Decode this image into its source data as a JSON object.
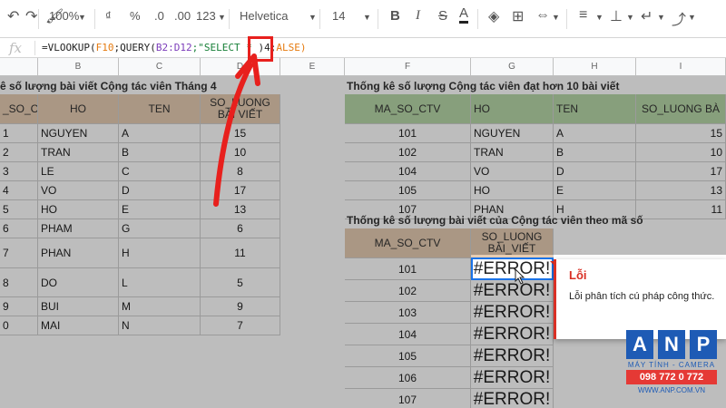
{
  "toolbar": {
    "zoom": "100%",
    "currency": "₫",
    "percent": "%",
    "decimal_less": ".0",
    "decimal_more": ".00",
    "number_format": "123",
    "font": "Helvetica",
    "font_size": "14",
    "bold": "B",
    "italic": "I",
    "strike": "S",
    "text_color": "A"
  },
  "formula_bar": {
    "fx": "fx",
    "p1": "=VLOOKUP(",
    "p2": "F10",
    "p3": ";QUERY(",
    "p4": "B2:D12",
    "p5": ";\"SELECT * ",
    "p6": ")4;",
    "p7": "ALSE)"
  },
  "columns": [
    "B",
    "C",
    "D",
    "E",
    "F",
    "G",
    "H",
    "I"
  ],
  "left_table": {
    "title": "ê số lượng bài viết Cộng tác viên Tháng 4",
    "headers": [
      "_SO_CTV",
      "HO",
      "TEN",
      "SO_LUONG BÀI VIẾT"
    ],
    "rows": [
      [
        "1",
        "NGUYEN",
        "A",
        "15"
      ],
      [
        "2",
        "TRAN",
        "B",
        "10"
      ],
      [
        "3",
        "LE",
        "C",
        "8"
      ],
      [
        "4",
        "VO",
        "D",
        "17"
      ],
      [
        "5",
        "HO",
        "E",
        "13"
      ],
      [
        "6",
        "PHAM",
        "G",
        "6"
      ],
      [
        "7",
        "PHAN",
        "H",
        "11"
      ],
      [
        "8",
        "DO",
        "L",
        "5"
      ],
      [
        "9",
        "BUI",
        "M",
        "9"
      ],
      [
        "0",
        "MAI",
        "N",
        "7"
      ]
    ]
  },
  "right_table": {
    "title": "Thống kê số lượng Cộng tác viên đạt hơn 10 bài viết",
    "headers": [
      "MA_SO_CTV",
      "HO",
      "TEN",
      "SO_LUONG BÀ"
    ],
    "rows": [
      [
        "101",
        "NGUYEN",
        "A",
        "15"
      ],
      [
        "102",
        "TRAN",
        "B",
        "10"
      ],
      [
        "104",
        "VO",
        "D",
        "17"
      ],
      [
        "105",
        "HO",
        "E",
        "13"
      ],
      [
        "107",
        "PHAN",
        "H",
        "11"
      ]
    ]
  },
  "lookup_table": {
    "title": "Thống kê số lượng bài viết của Cộng tác viên theo mã số",
    "headers": [
      "MA_SO_CTV",
      "SO_LUONG BÀI_VIẾT"
    ],
    "rows": [
      [
        "101",
        "#ERROR!"
      ],
      [
        "102",
        "#ERROR!"
      ],
      [
        "103",
        "#ERROR!"
      ],
      [
        "104",
        "#ERROR!"
      ],
      [
        "105",
        "#ERROR!"
      ],
      [
        "106",
        "#ERROR!"
      ],
      [
        "107",
        "#ERROR!"
      ]
    ]
  },
  "tooltip": {
    "title": "Lỗi",
    "message": "Lỗi phân tích cú pháp công thức."
  },
  "logo": {
    "letters": [
      "A",
      "N",
      "P"
    ],
    "subtitle": "MÁY TÍNH - CAMERA",
    "phone": "098 772 0 772",
    "web": "WWW.ANP.COM.VN"
  },
  "colors": {
    "header_tan": "#e6ccb2",
    "header_green": "#b7d7a8",
    "error_red": "#d93025",
    "arrow_red": "#e8201d",
    "logo_blue": "#1e5bb5"
  }
}
